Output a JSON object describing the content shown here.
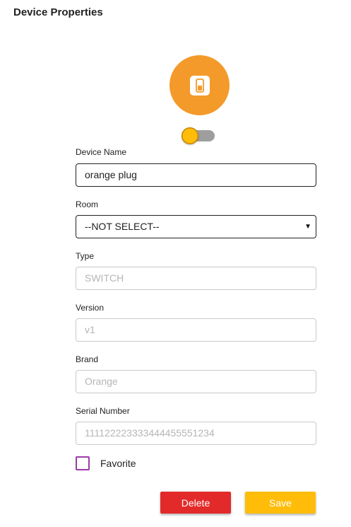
{
  "page": {
    "title": "Device Properties"
  },
  "device": {
    "icon": "switch-icon",
    "icon_color": "#f39a2b",
    "power_on": false
  },
  "form": {
    "device_name": {
      "label": "Device Name",
      "value": "orange plug"
    },
    "room": {
      "label": "Room",
      "value": "--NOT SELECT--"
    },
    "type": {
      "label": "Type",
      "placeholder": "SWITCH"
    },
    "version": {
      "label": "Version",
      "placeholder": "v1"
    },
    "brand": {
      "label": "Brand",
      "placeholder": "Orange"
    },
    "serial_number": {
      "label": "Serial Number",
      "placeholder": "111122223333444455551234"
    },
    "favorite": {
      "label": "Favorite",
      "checked": false
    }
  },
  "actions": {
    "delete_label": "Delete",
    "save_label": "Save"
  },
  "colors": {
    "accent": "#ffbd0a",
    "danger": "#e22a2a",
    "checkbox": "#9c3ba8"
  }
}
